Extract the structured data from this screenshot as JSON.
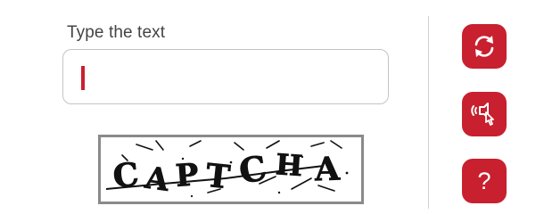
{
  "input": {
    "label": "Type the text",
    "value": "",
    "placeholder": ""
  },
  "captcha": {
    "text": "CAPTCHA"
  },
  "buttons": {
    "refresh_icon": "refresh-icon",
    "audio_icon": "audio-icon",
    "help_glyph": "?"
  },
  "colors": {
    "accent": "#c8202f",
    "label": "#444444",
    "field_border": "#c4c4c4"
  }
}
